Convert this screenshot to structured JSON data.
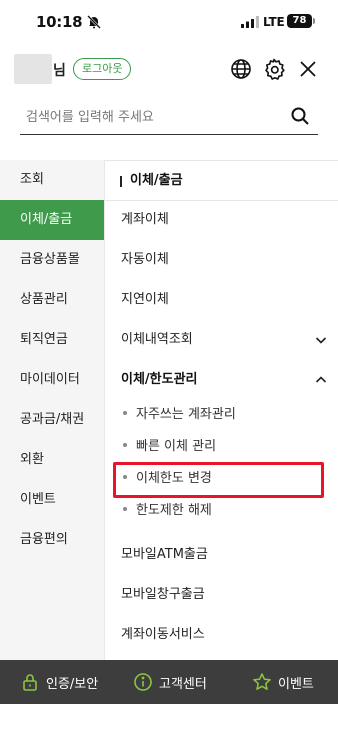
{
  "status_bar": {
    "time": "10:18",
    "network": "LTE",
    "battery": "78"
  },
  "header": {
    "user_suffix": "님",
    "logout_label": "로그아웃",
    "icons": [
      "globe-icon",
      "gear-icon",
      "close-icon"
    ]
  },
  "search": {
    "placeholder": "검색어를 입력해 주세요",
    "value": ""
  },
  "sidebar": {
    "items": [
      {
        "label": "조회",
        "active": false
      },
      {
        "label": "이체/출금",
        "active": true
      },
      {
        "label": "금융상품몰",
        "active": false
      },
      {
        "label": "상품관리",
        "active": false
      },
      {
        "label": "퇴직연금",
        "active": false
      },
      {
        "label": "마이데이터",
        "active": false
      },
      {
        "label": "공과금/채권",
        "active": false
      },
      {
        "label": "외환",
        "active": false
      },
      {
        "label": "이벤트",
        "active": false
      },
      {
        "label": "금융편의",
        "active": false
      }
    ]
  },
  "content": {
    "section_title": "이체/출금",
    "menu": [
      {
        "label": "계좌이체"
      },
      {
        "label": "자동이체"
      },
      {
        "label": "지연이체"
      },
      {
        "label": "이체내역조회",
        "chevron": "chevron-down-icon"
      },
      {
        "label": "이체/한도관리",
        "chevron": "chevron-up-icon",
        "expanded": true
      }
    ],
    "submenu": [
      {
        "label": "자주쓰는 계좌관리"
      },
      {
        "label": "빠른 이체 관리"
      },
      {
        "label": "이체한도 변경",
        "highlighted": true
      },
      {
        "label": "한도제한 해제"
      }
    ],
    "menu_after": [
      {
        "label": "모바일ATM출금"
      },
      {
        "label": "모바일창구출금"
      },
      {
        "label": "계좌이동서비스"
      }
    ]
  },
  "bottom_bar": {
    "items": [
      {
        "label": "인증/보안",
        "icon": "lock-icon"
      },
      {
        "label": "고객센터",
        "icon": "info-icon"
      },
      {
        "label": "이벤트",
        "icon": "star-icon"
      }
    ]
  },
  "colors": {
    "accent_green": "#3f9b4b",
    "highlight_red": "#e8142a",
    "bottom_bar": "#3d3d3d"
  }
}
